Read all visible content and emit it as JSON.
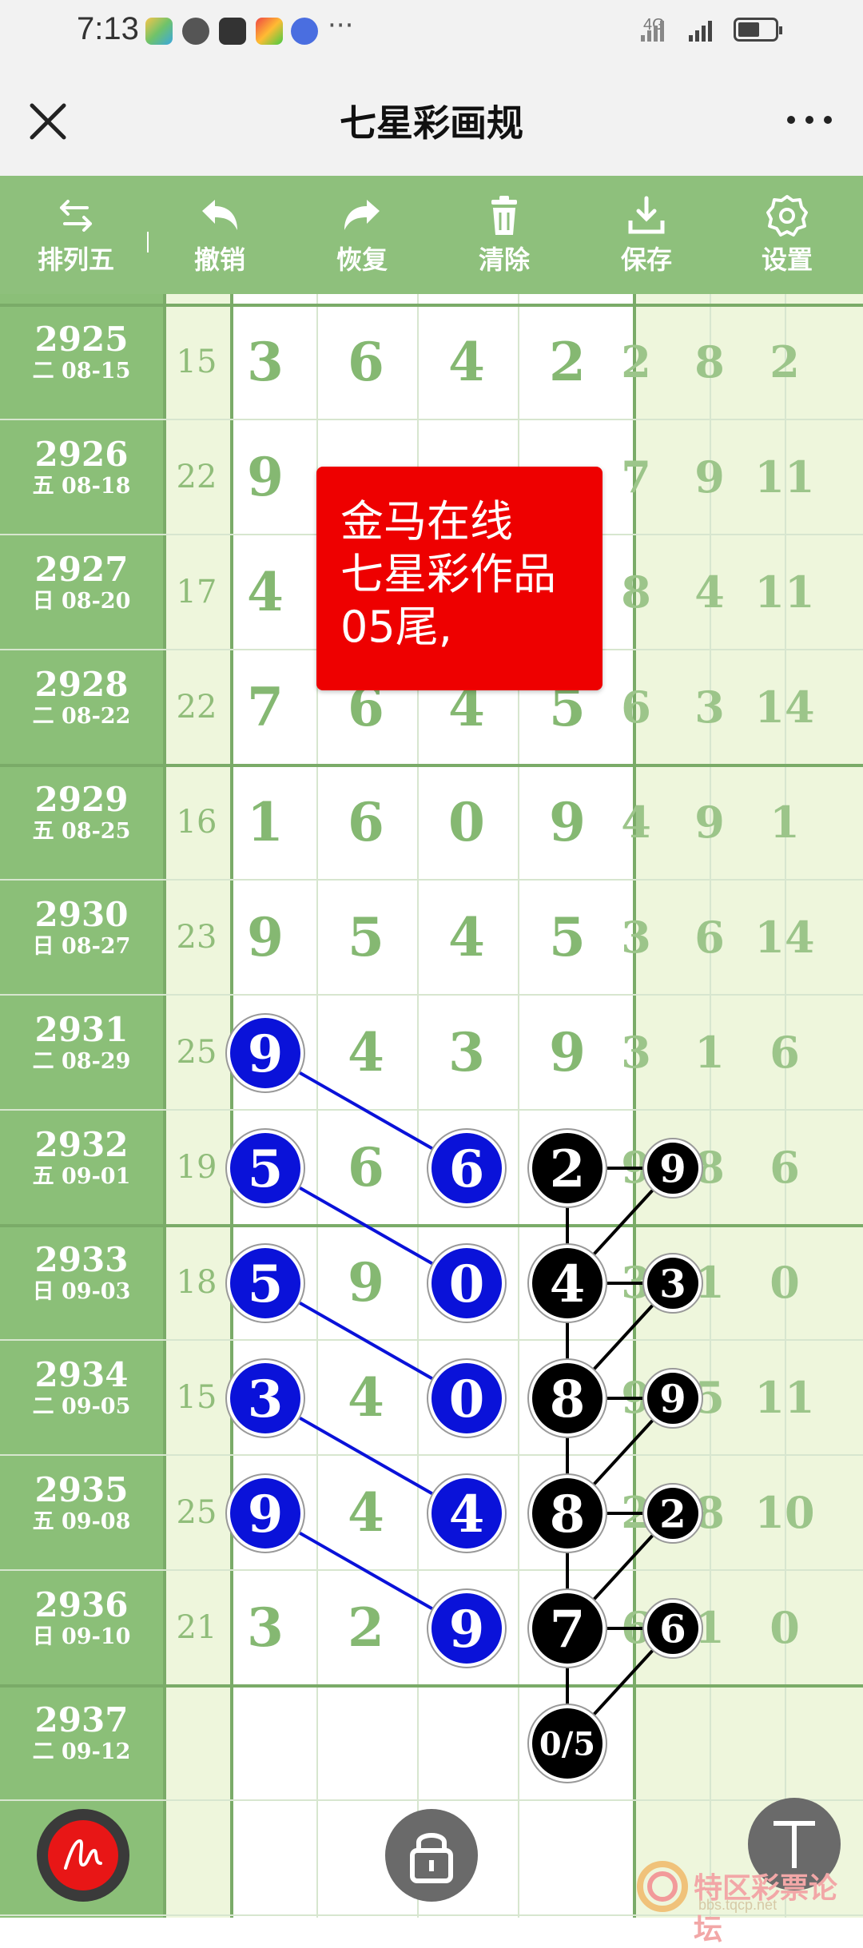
{
  "status_bar": {
    "time": "7:13",
    "more": "···",
    "network": "4G"
  },
  "app": {
    "title": "七星彩画规"
  },
  "toolbar": {
    "items": [
      {
        "label": "排列五",
        "icon": "swap-arrows-icon"
      },
      {
        "label": "撤销",
        "icon": "undo-icon"
      },
      {
        "label": "恢复",
        "icon": "redo-icon"
      },
      {
        "label": "清除",
        "icon": "trash-icon"
      },
      {
        "label": "保存",
        "icon": "download-icon"
      },
      {
        "label": "设置",
        "icon": "gear-icon"
      }
    ]
  },
  "rows": [
    {
      "issue": "2925",
      "date": "二 08-15",
      "sum": "15",
      "digits": [
        "3",
        "6",
        "4",
        "2"
      ],
      "extra": [
        "2",
        "8",
        "2"
      ]
    },
    {
      "issue": "2926",
      "date": "五 08-18",
      "sum": "22",
      "digits": [
        "9",
        "",
        "",
        ""
      ],
      "extra": [
        "7",
        "9",
        "11"
      ]
    },
    {
      "issue": "2927",
      "date": "日 08-20",
      "sum": "17",
      "digits": [
        "4",
        "",
        "",
        ""
      ],
      "extra": [
        "8",
        "4",
        "11"
      ]
    },
    {
      "issue": "2928",
      "date": "二 08-22",
      "sum": "22",
      "digits": [
        "7",
        "6",
        "4",
        "5"
      ],
      "extra": [
        "6",
        "3",
        "14"
      ]
    },
    {
      "issue": "2929",
      "date": "五 08-25",
      "sum": "16",
      "digits": [
        "1",
        "6",
        "0",
        "9"
      ],
      "extra": [
        "4",
        "9",
        "1"
      ]
    },
    {
      "issue": "2930",
      "date": "日 08-27",
      "sum": "23",
      "digits": [
        "9",
        "5",
        "4",
        "5"
      ],
      "extra": [
        "3",
        "6",
        "14"
      ]
    },
    {
      "issue": "2931",
      "date": "二 08-29",
      "sum": "25",
      "digits": [
        "9",
        "4",
        "3",
        "9"
      ],
      "extra": [
        "3",
        "1",
        "6"
      ]
    },
    {
      "issue": "2932",
      "date": "五 09-01",
      "sum": "19",
      "digits": [
        "5",
        "6",
        "6",
        "2"
      ],
      "extra": [
        "9",
        "8",
        "6"
      ]
    },
    {
      "issue": "2933",
      "date": "日 09-03",
      "sum": "18",
      "digits": [
        "5",
        "9",
        "0",
        "4"
      ],
      "extra": [
        "3",
        "1",
        "0"
      ]
    },
    {
      "issue": "2934",
      "date": "二 09-05",
      "sum": "15",
      "digits": [
        "3",
        "4",
        "0",
        "8"
      ],
      "extra": [
        "9",
        "5",
        "11"
      ]
    },
    {
      "issue": "2935",
      "date": "五 09-08",
      "sum": "25",
      "digits": [
        "9",
        "4",
        "4",
        "8"
      ],
      "extra": [
        "2",
        "8",
        "10"
      ]
    },
    {
      "issue": "2936",
      "date": "日 09-10",
      "sum": "21",
      "digits": [
        "3",
        "2",
        "9",
        "7"
      ],
      "extra": [
        "6",
        "1",
        "0"
      ]
    },
    {
      "issue": "2937",
      "date": "二 09-12",
      "sum": "",
      "digits": [
        "",
        "",
        "",
        "0/5"
      ],
      "extra": [
        "",
        "",
        ""
      ]
    },
    {
      "issue": "",
      "date": "",
      "sum": "",
      "digits": [
        "",
        "",
        "",
        ""
      ],
      "extra": [
        "",
        "",
        ""
      ]
    }
  ],
  "blue_marks": [
    {
      "row": 6,
      "col": 0,
      "value": "9"
    },
    {
      "row": 7,
      "col": 2,
      "value": "6"
    },
    {
      "row": 7,
      "col": 0,
      "value": "5"
    },
    {
      "row": 8,
      "col": 2,
      "value": "0"
    },
    {
      "row": 8,
      "col": 0,
      "value": "5"
    },
    {
      "row": 9,
      "col": 2,
      "value": "0"
    },
    {
      "row": 9,
      "col": 0,
      "value": "3"
    },
    {
      "row": 10,
      "col": 2,
      "value": "4"
    },
    {
      "row": 10,
      "col": 0,
      "value": "9"
    },
    {
      "row": 11,
      "col": 2,
      "value": "9"
    }
  ],
  "black_marks": [
    {
      "row": 7,
      "col": 3,
      "value": "2"
    },
    {
      "row": 8,
      "col": 3,
      "value": "4"
    },
    {
      "row": 9,
      "col": 3,
      "value": "8"
    },
    {
      "row": 10,
      "col": 3,
      "value": "8"
    },
    {
      "row": 11,
      "col": 3,
      "value": "7"
    },
    {
      "row": 12,
      "col": 3,
      "value": "0/5"
    }
  ],
  "black_small_marks": [
    {
      "row": 7,
      "value": "9"
    },
    {
      "row": 8,
      "value": "3"
    },
    {
      "row": 9,
      "value": "9"
    },
    {
      "row": 10,
      "value": "2"
    },
    {
      "row": 11,
      "value": "6"
    }
  ],
  "note": {
    "lines": [
      "金马在线",
      "七星彩作品",
      "05尾,"
    ]
  },
  "watermark": {
    "text": "特区彩票论坛",
    "sub": "bbs.tqcp.net"
  },
  "colors": {
    "header_green": "#8ec07c",
    "issue_green": "#8bbf78",
    "band_light": "#eef6dc",
    "blue_ball": "#0a12d9",
    "black_ball": "#000000",
    "note_red": "#ee0000"
  }
}
